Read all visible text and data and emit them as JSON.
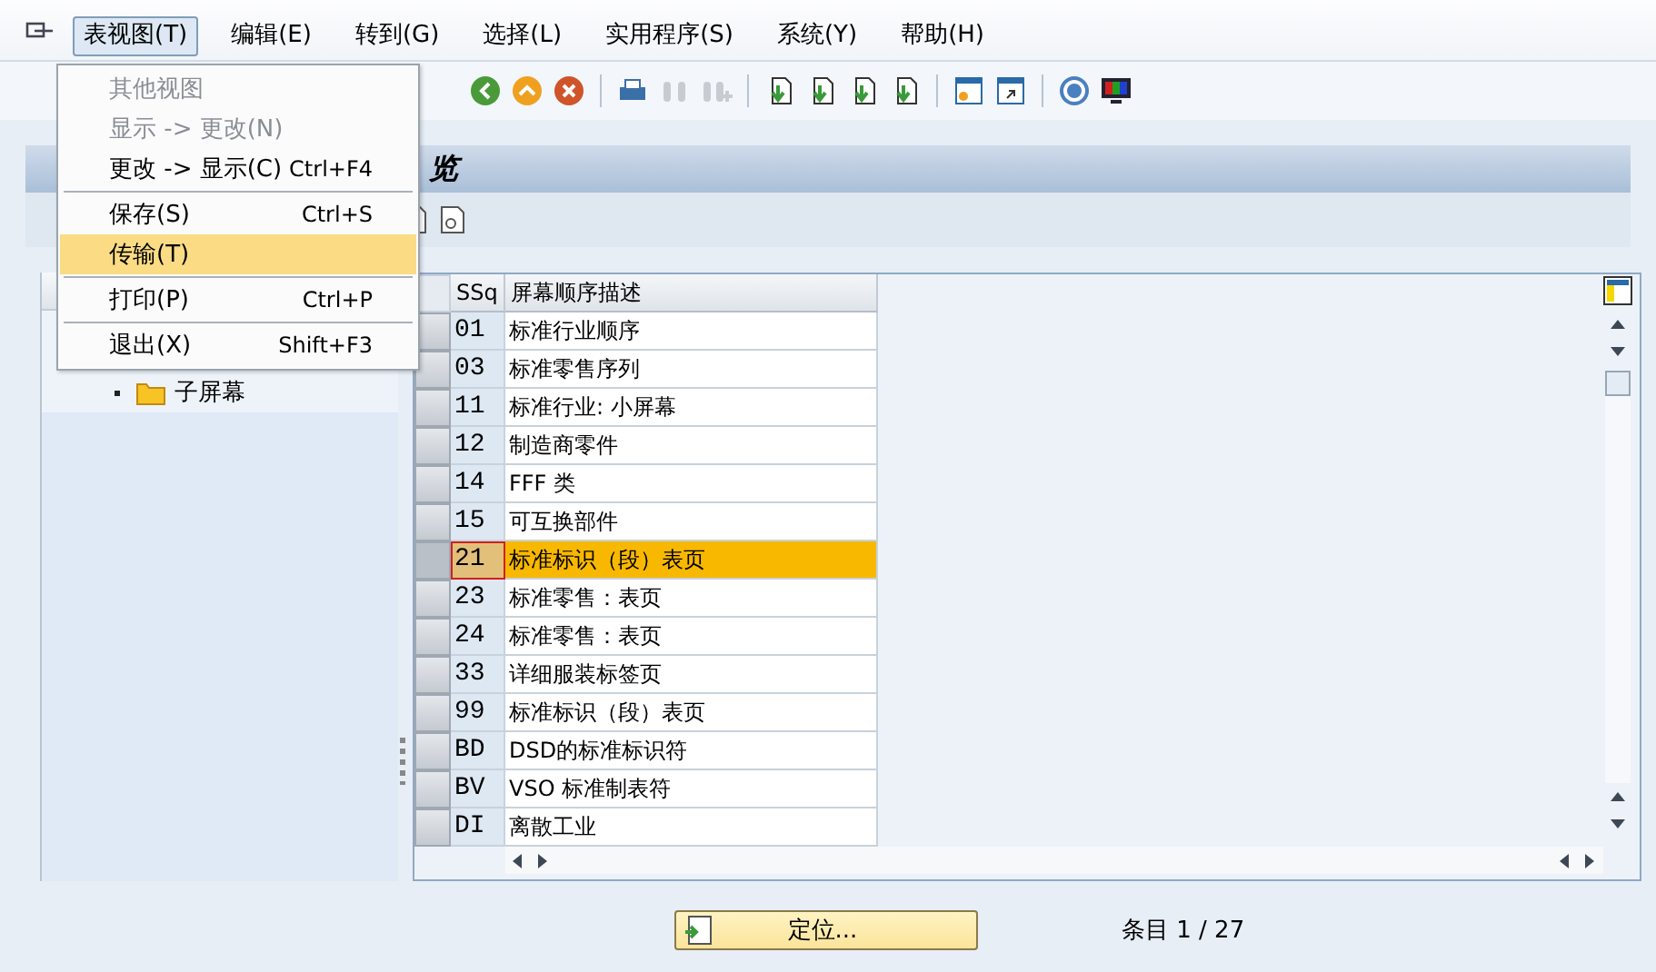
{
  "menu_bar": [
    {
      "label": "表视图(T)",
      "selected": true
    },
    {
      "label": "编辑(E)",
      "selected": false
    },
    {
      "label": "转到(G)",
      "selected": false
    },
    {
      "label": "选择(L)",
      "selected": false
    },
    {
      "label": "实用程序(S)",
      "selected": false
    },
    {
      "label": "系统(Y)",
      "selected": false
    },
    {
      "label": "帮助(H)",
      "selected": false
    }
  ],
  "dropdown": [
    {
      "kind": "item",
      "label": "其他视图",
      "disabled": true,
      "selected": false
    },
    {
      "kind": "item",
      "label": "显示 -> 更改(N)",
      "disabled": true,
      "selected": false
    },
    {
      "kind": "item",
      "label": "更改 -> 显示(C)",
      "shortcut": "Ctrl+F4",
      "disabled": false,
      "selected": false
    },
    {
      "kind": "separator"
    },
    {
      "kind": "item",
      "label": "保存(S)",
      "shortcut": "Ctrl+S",
      "disabled": false,
      "selected": false
    },
    {
      "kind": "item",
      "label": "传输(T)",
      "disabled": false,
      "selected": true
    },
    {
      "kind": "separator"
    },
    {
      "kind": "item",
      "label": "打印(P)",
      "shortcut": "Ctrl+P",
      "disabled": false,
      "selected": false
    },
    {
      "kind": "separator"
    },
    {
      "kind": "item",
      "label": "退出(X)",
      "shortcut": "Shift+F3",
      "disabled": false,
      "selected": false
    }
  ],
  "title": "览",
  "tree": [
    {
      "label": "子屏幕"
    }
  ],
  "table": {
    "columns": [
      "SSq",
      "屏幕顺序描述"
    ],
    "rows": [
      {
        "ssq": "01",
        "desc": "标准行业顺序",
        "selected": false
      },
      {
        "ssq": "03",
        "desc": "标准零售序列",
        "selected": false
      },
      {
        "ssq": "11",
        "desc": "标准行业: 小屏幕",
        "selected": false
      },
      {
        "ssq": "12",
        "desc": "制造商零件",
        "selected": false
      },
      {
        "ssq": "14",
        "desc": "FFF 类",
        "selected": false
      },
      {
        "ssq": "15",
        "desc": "可互换部件",
        "selected": false
      },
      {
        "ssq": "21",
        "desc": "标准标识（段）表页",
        "selected": true
      },
      {
        "ssq": "23",
        "desc": "标准零售：表页",
        "selected": false
      },
      {
        "ssq": "24",
        "desc": "标准零售：表页",
        "selected": false
      },
      {
        "ssq": "33",
        "desc": "详细服装标签页",
        "selected": false
      },
      {
        "ssq": "99",
        "desc": "标准标识（段）表页",
        "selected": false
      },
      {
        "ssq": "BD",
        "desc": "DSD的标准标识符",
        "selected": false
      },
      {
        "ssq": "BV",
        "desc": "VSO 标准制表符",
        "selected": false
      },
      {
        "ssq": "DI",
        "desc": "离散工业",
        "selected": false
      }
    ]
  },
  "position_button": "定位...",
  "entry_label": "条目 1 / 27"
}
